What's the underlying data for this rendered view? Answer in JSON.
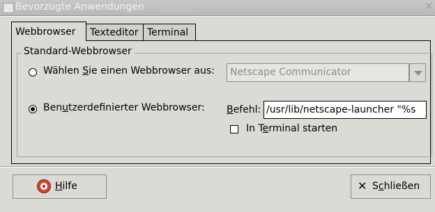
{
  "window": {
    "title": "Bevorzugte Anwendungen"
  },
  "tabs": [
    {
      "label": "Webbrowser",
      "active": true
    },
    {
      "label": "Texteditor",
      "active": false
    },
    {
      "label": "Terminal",
      "active": false
    }
  ],
  "group": {
    "label": "Standard-Webbrowser"
  },
  "option_select": {
    "label_pre": "Wählen ",
    "label_mnemonic": "S",
    "label_post": "ie einen Webbrowser aus:",
    "selected": "Netscape Communicator",
    "checked": false
  },
  "option_custom": {
    "label_pre": "Ben",
    "label_mnemonic": "u",
    "label_post": "tzerdefinierter Webbrowser:",
    "checked": true
  },
  "command": {
    "label_mnemonic": "B",
    "label_post": "efehl:",
    "value": "/usr/lib/netscape-launcher \"%s"
  },
  "terminal_check": {
    "label_pre": "In T",
    "label_mnemonic": "e",
    "label_post": "rminal starten",
    "checked": false
  },
  "buttons": {
    "help": {
      "label_mnemonic": "H",
      "label_post": "ilfe"
    },
    "close": {
      "label_pre": "S",
      "label_mnemonic": "c",
      "label_post": "hließen"
    }
  }
}
